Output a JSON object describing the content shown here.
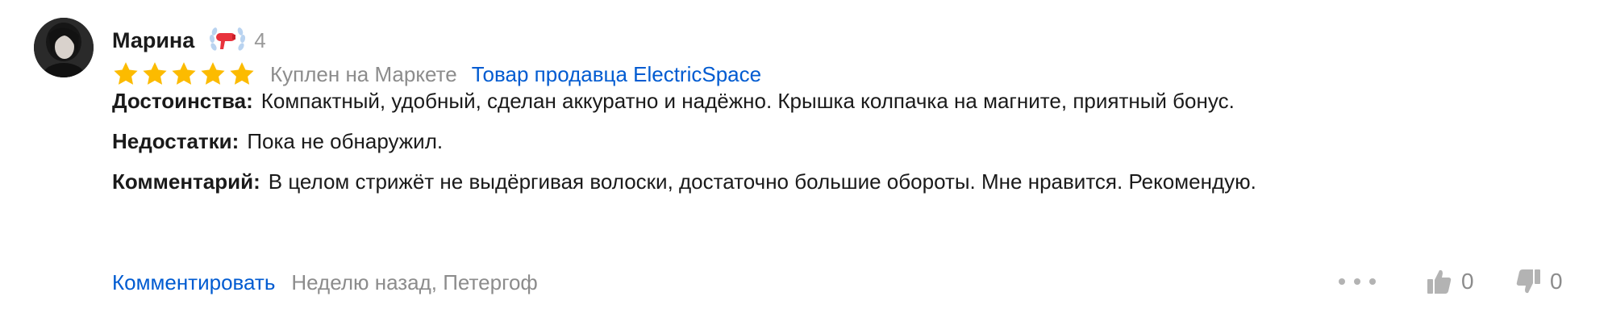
{
  "author": {
    "name": "Марина",
    "badge_icon": "hair-dryer-laurel-icon",
    "badge_level": "4"
  },
  "rating": {
    "stars": 5,
    "max": 5,
    "star_color": "#fcbb00"
  },
  "purchase_info": "Куплен на Маркете",
  "seller_link": "Товар продавца ElectricSpace",
  "review": {
    "pros_label": "Достоинства:",
    "pros_text": "Компактный, удобный, сделан аккуратно и надёжно. Крышка колпачка на магните, приятный бонус.",
    "cons_label": "Недостатки:",
    "cons_text": "Пока не обнаружил.",
    "comment_label": "Комментарий:",
    "comment_text": "В целом стрижёт не выдёргивая волоски, достаточно большие обороты. Мне нравится. Рекомендую."
  },
  "footer": {
    "comment_action": "Комментировать",
    "date_location": "Неделю назад, Петергоф",
    "likes": "0",
    "dislikes": "0"
  },
  "colors": {
    "link": "#005bd1",
    "muted": "#8c8c8c",
    "icon": "#b3b3b3"
  }
}
